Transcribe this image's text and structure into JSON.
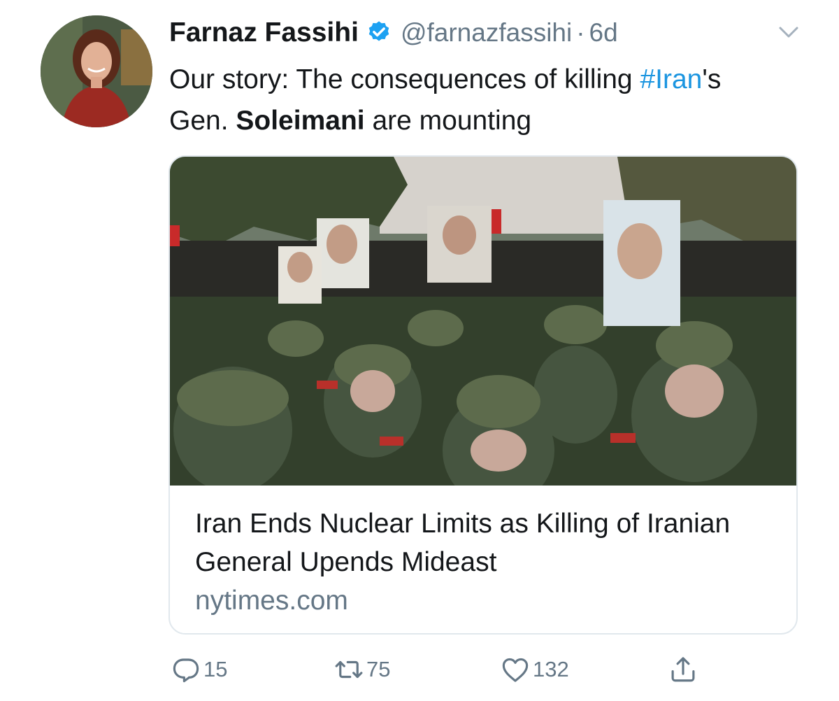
{
  "author": {
    "name": "Farnaz Fassihi",
    "handle": "@farnazfassihi",
    "separator": "·",
    "time": "6d"
  },
  "tweet": {
    "text_prefix": "Our story: The consequences of killing ",
    "hashtag": "#Iran",
    "text_middle": "'s Gen. ",
    "bold_text": "Soleimani",
    "text_suffix": " are mounting"
  },
  "card": {
    "title": "Iran Ends Nuclear Limits as Killing of Iranian General Upends Mideast",
    "domain": "nytimes.com"
  },
  "actions": {
    "replies": "15",
    "retweets": "75",
    "likes": "132"
  },
  "icons": [
    "verified-icon",
    "chevron-down-icon",
    "reply-icon",
    "retweet-icon",
    "like-icon",
    "share-icon"
  ],
  "colors": {
    "link": "#1b95e0",
    "verified": "#1da1f2",
    "secondary_text": "#657786",
    "border": "#e1e8ed"
  }
}
